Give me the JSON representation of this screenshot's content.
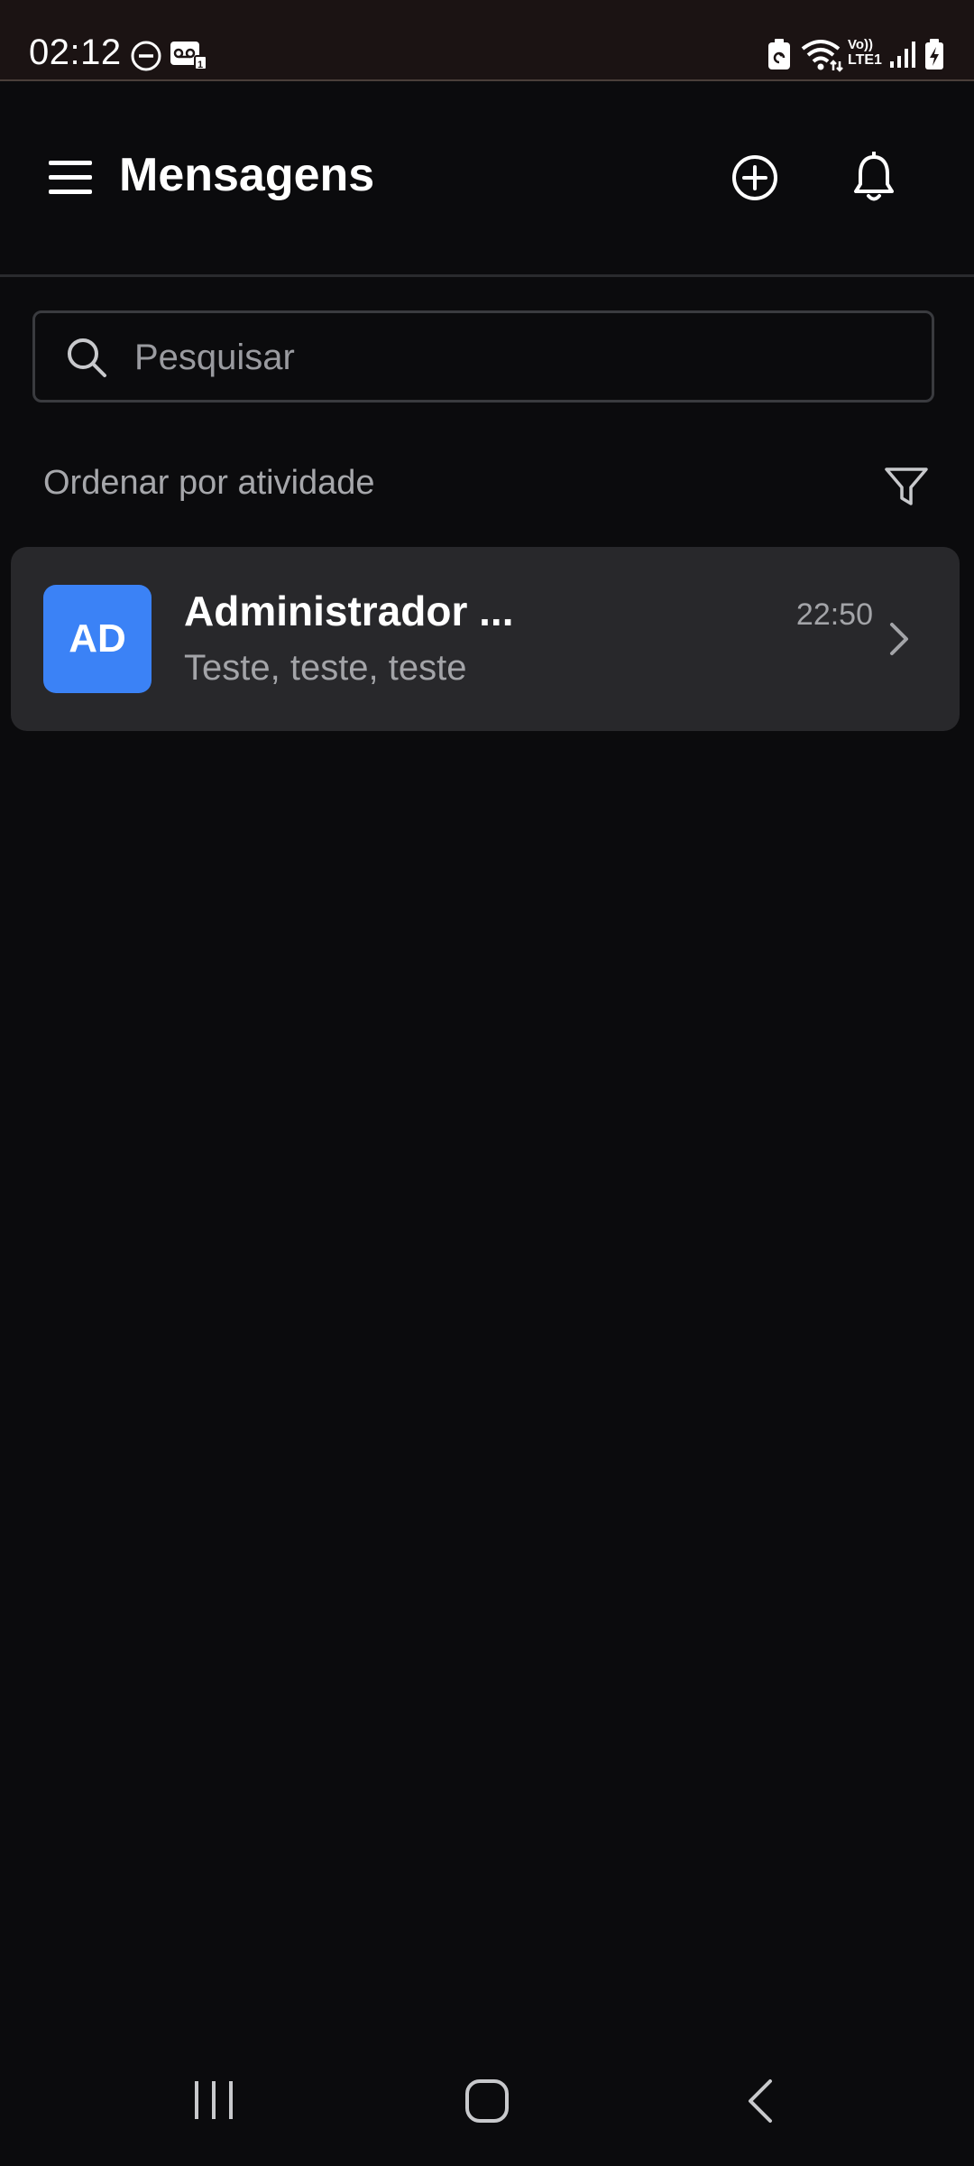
{
  "status_bar": {
    "time": "02:12",
    "network_text_top": "Vo))",
    "network_text_bottom": "LTE1",
    "icons": [
      "do-not-disturb-icon",
      "voicemail-icon",
      "battery-saver-icon",
      "wifi-icon",
      "volte-icon",
      "signal-icon",
      "battery-charging-icon"
    ]
  },
  "header": {
    "title": "Mensagens",
    "icons": [
      "menu-icon",
      "add-circle-icon",
      "bell-icon"
    ]
  },
  "search": {
    "placeholder": "Pesquisar",
    "value": ""
  },
  "sort": {
    "label": "Ordenar por atividade",
    "icon": "filter-icon"
  },
  "conversations": [
    {
      "initials": "AD",
      "name": "Administrador ...",
      "preview": "Teste, teste, teste",
      "time": "22:50",
      "avatar_color": "#3b82f6"
    }
  ],
  "nav_bar": {
    "buttons": [
      "recent-apps-icon",
      "home-icon",
      "back-icon"
    ]
  },
  "colors": {
    "background": "#0b0b0d",
    "status_bar": "#1b1313",
    "card": "#28282b",
    "accent": "#3b82f6",
    "muted_text": "#a3a4a8"
  }
}
